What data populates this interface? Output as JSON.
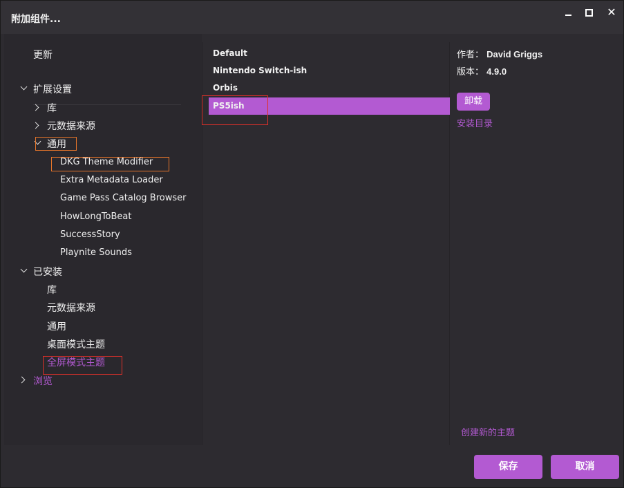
{
  "window": {
    "title": "附加组件...",
    "minimize_icon": "minimize-icon",
    "maximize_icon": "maximize-icon",
    "close_icon": "close-icon",
    "close_glyph": "✕"
  },
  "sidebar": {
    "update": "更新",
    "extension_settings": {
      "label": "扩展设置",
      "children": {
        "library": "库",
        "metadata_sources": "元数据来源",
        "general": "通用",
        "general_children": [
          "DKG Theme Modifier",
          "Extra Metadata Loader",
          "Game Pass Catalog Browser",
          "HowLongToBeat",
          "SuccessStory",
          "Playnite Sounds"
        ]
      }
    },
    "installed": {
      "label": "已安装",
      "children": [
        "库",
        "元数据来源",
        "通用",
        "桌面模式主题",
        "全屏模式主题"
      ]
    },
    "browse": "浏览"
  },
  "themes": {
    "items": [
      "Default",
      "Nintendo Switch-ish",
      "Orbis",
      "PS5ish"
    ],
    "selected_index": 3
  },
  "details": {
    "author_label": "作者：",
    "author": "David Griggs",
    "version_label": "版本：",
    "version": "4.9.0",
    "uninstall": "卸载",
    "install_dir": "安装目录",
    "create_theme": "创建新的主题"
  },
  "footer": {
    "save": "保存",
    "cancel": "取消"
  },
  "colors": {
    "accent": "#b35ad2",
    "background": "#2d2b30",
    "annotation_red": "#e0302a",
    "annotation_orange": "#e8762a"
  }
}
